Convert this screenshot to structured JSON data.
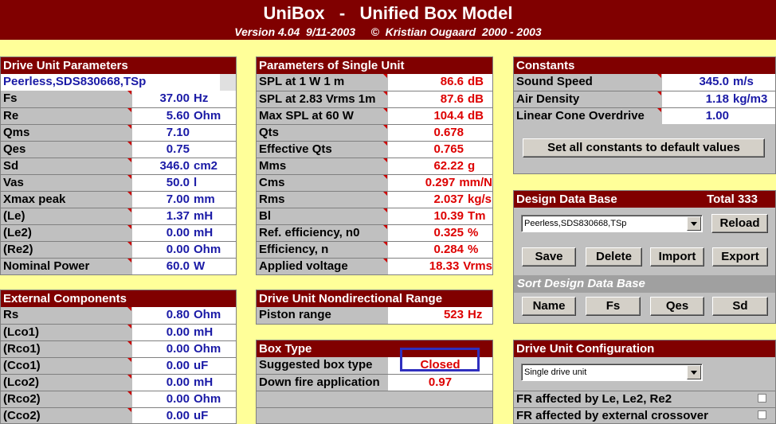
{
  "title": "UniBox   -   Unified Box Model",
  "subtitle": "Version 4.04  9/11-2003     ©  Kristian Ougaard  2000 - 2003",
  "drive_unit": {
    "header": "Drive Unit Parameters",
    "name": "Peerless,SDS830668,TSp",
    "rows": [
      {
        "label": "Fs",
        "value": "37.00",
        "unit": "Hz"
      },
      {
        "label": "Re",
        "value": "5.60",
        "unit": "Ohm"
      },
      {
        "label": "Qms",
        "value": "7.10",
        "unit": ""
      },
      {
        "label": "Qes",
        "value": "0.75",
        "unit": ""
      },
      {
        "label": "Sd",
        "value": "346.0",
        "unit": "cm2"
      },
      {
        "label": "Vas",
        "value": "50.0",
        "unit": "l"
      },
      {
        "label": "Xmax peak",
        "value": "7.00",
        "unit": "mm"
      },
      {
        "label": "(Le)",
        "value": "1.37",
        "unit": "mH"
      },
      {
        "label": "(Le2)",
        "value": "0.00",
        "unit": "mH"
      },
      {
        "label": "(Re2)",
        "value": "0.00",
        "unit": "Ohm"
      },
      {
        "label": "Nominal Power",
        "value": "60.0",
        "unit": "W"
      }
    ]
  },
  "external": {
    "header": "External Components",
    "rows": [
      {
        "label": "Rs",
        "value": "0.80",
        "unit": "Ohm"
      },
      {
        "label": "(Lco1)",
        "value": "0.00",
        "unit": "mH"
      },
      {
        "label": "(Rco1)",
        "value": "0.00",
        "unit": "Ohm"
      },
      {
        "label": "(Cco1)",
        "value": "0.00",
        "unit": "uF"
      },
      {
        "label": "(Lco2)",
        "value": "0.00",
        "unit": "mH"
      },
      {
        "label": "(Rco2)",
        "value": "0.00",
        "unit": "Ohm"
      },
      {
        "label": "(Cco2)",
        "value": "0.00",
        "unit": "uF"
      }
    ]
  },
  "single_unit": {
    "header": "Parameters of Single Unit",
    "rows": [
      {
        "label": "SPL at 1 W 1 m",
        "value": "86.6",
        "unit": "dB"
      },
      {
        "label": "SPL at 2.83 Vrms 1m",
        "value": "87.6",
        "unit": "dB"
      },
      {
        "label": "Max SPL at 60 W",
        "value": "104.4",
        "unit": "dB"
      },
      {
        "label": "Qts",
        "value": "0.678",
        "unit": ""
      },
      {
        "label": "Effective Qts",
        "value": "0.765",
        "unit": ""
      },
      {
        "label": "Mms",
        "value": "62.22",
        "unit": "g"
      },
      {
        "label": "Cms",
        "value": "0.297",
        "unit": "mm/N"
      },
      {
        "label": "Rms",
        "value": "2.037",
        "unit": "kg/s"
      },
      {
        "label": "Bl",
        "value": "10.39",
        "unit": "Tm"
      },
      {
        "label": "Ref. efficiency, n0",
        "value": "0.325",
        "unit": "%"
      },
      {
        "label": "Efficiency, n",
        "value": "0.284",
        "unit": "%"
      },
      {
        "label": "Applied voltage",
        "value": "18.33",
        "unit": "Vrms"
      }
    ]
  },
  "nondirectional": {
    "header": "Drive Unit Nondirectional Range",
    "rows": [
      {
        "label": "Piston range",
        "value": "523",
        "unit": "Hz"
      }
    ]
  },
  "box_type": {
    "header": "Box Type",
    "rows": [
      {
        "label": "Suggested box type",
        "value": "Closed"
      },
      {
        "label": "Down fire application",
        "value": "0.97"
      }
    ]
  },
  "constants": {
    "header": "Constants",
    "rows": [
      {
        "label": "Sound Speed",
        "value": "345.0",
        "unit": "m/s"
      },
      {
        "label": "Air Density",
        "value": "1.18",
        "unit": "kg/m3"
      },
      {
        "label": "Linear Cone Overdrive",
        "value": "1.00",
        "unit": ""
      }
    ],
    "default_button": "Set all constants to default values"
  },
  "database": {
    "header": "Design Data Base",
    "total": "Total  333",
    "selected": "Peerless,SDS830668,TSp",
    "reload": "Reload",
    "save": "Save",
    "delete": "Delete",
    "import": "Import",
    "export": "Export",
    "sort_header": "Sort Design Data Base",
    "sort_name": "Name",
    "sort_fs": "Fs",
    "sort_qes": "Qes",
    "sort_sd": "Sd"
  },
  "configuration": {
    "header": "Drive Unit Configuration",
    "selected": "Single drive unit",
    "fr_le": "FR affected by Le, Le2, Re2",
    "fr_crossover": "FR affected by external crossover"
  },
  "colors": {
    "header_bg": "#800000",
    "page_bg": "#ffff99",
    "value_blue": "#1a1aa6",
    "value_red": "#dd0000",
    "selection_box": "#2f2fbf"
  }
}
